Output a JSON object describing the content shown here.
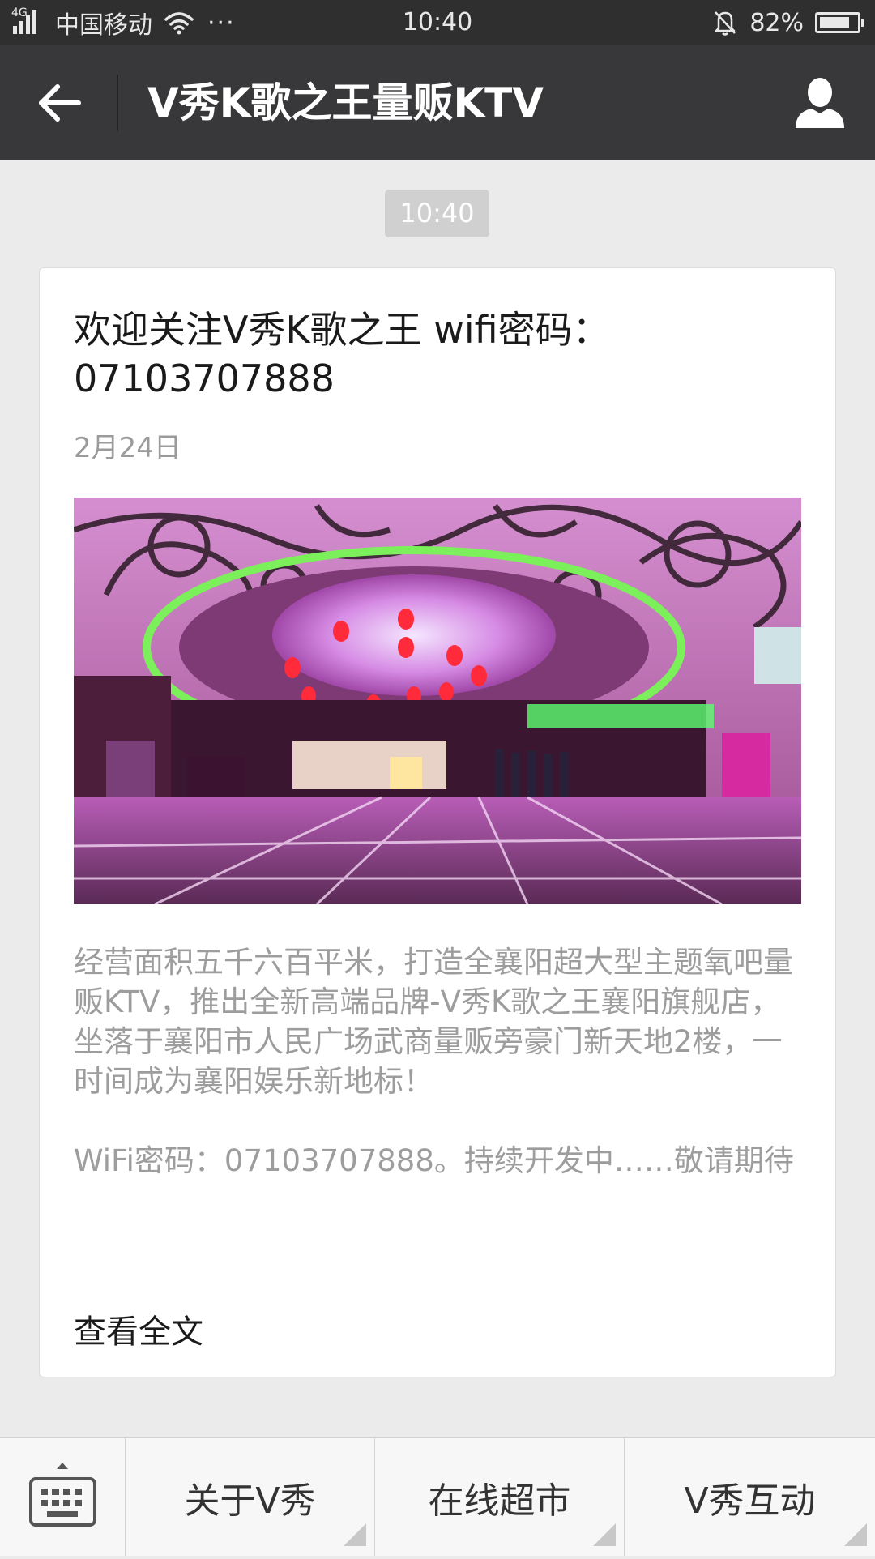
{
  "status_bar": {
    "network_type": "4G",
    "carrier": "中国移动",
    "more": "···",
    "time": "10:40",
    "battery": "82%",
    "battery_level": 0.82
  },
  "header": {
    "title": "V秀K歌之王量贩KTV",
    "back_icon": "arrow-left-icon",
    "profile_icon": "person-icon"
  },
  "conversation": {
    "timestamp": "10:40",
    "article": {
      "title": "欢迎关注V秀K歌之王 wifi密码：07103707888",
      "date": "2月24日",
      "image": "ktv-lobby-photo",
      "paragraphs": [
        "经营面积五千六百平米，打造全襄阳超大型主题氧吧量贩KTV，推出全新高端品牌-V秀K歌之王襄阳旗舰店，坐落于襄阳市人民广场武商量贩旁豪门新天地2楼，一时间成为襄阳娱乐新地标！",
        "WiFi密码：07103707888。持续开发中……敬请期待"
      ],
      "read_more": "查看全文"
    }
  },
  "bottom_menu": {
    "keyboard_icon": "keyboard-icon",
    "items": [
      {
        "label": "关于V秀"
      },
      {
        "label": "在线超市"
      },
      {
        "label": "V秀互动"
      }
    ]
  },
  "colors": {
    "status_bar": "#2f2f30",
    "title_bar": "#38383a",
    "background": "#ebebeb",
    "summary_text": "#9d9d9d"
  }
}
